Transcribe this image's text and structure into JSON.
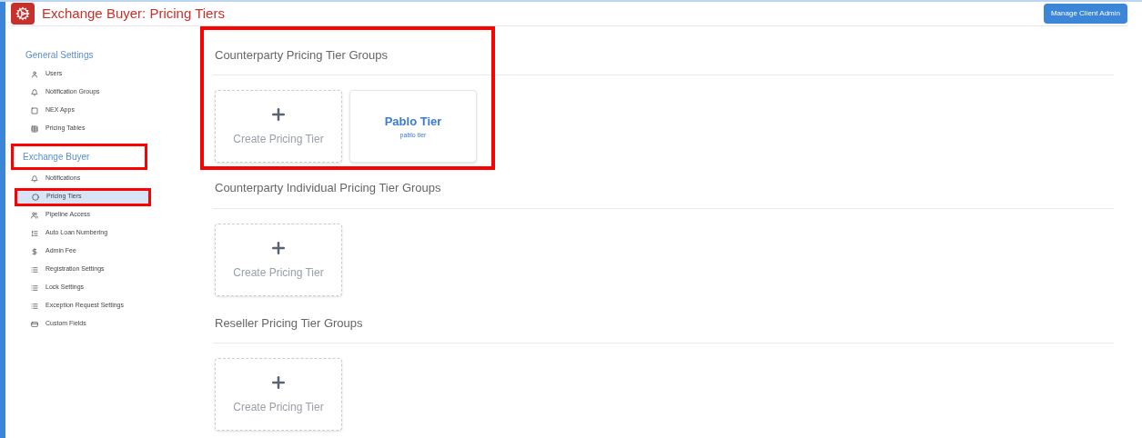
{
  "header": {
    "title": "Exchange Buyer: Pricing Tiers",
    "button": "Manage Client Admin"
  },
  "sidebar": [
    {
      "heading": "General Settings",
      "highlighted": false,
      "items": [
        {
          "label": "Users",
          "selected": false,
          "highlighted": false
        },
        {
          "label": "Notification Groups",
          "selected": false,
          "highlighted": false
        },
        {
          "label": "NEX Apps",
          "selected": false,
          "highlighted": false
        },
        {
          "label": "Pricing Tables",
          "selected": false,
          "highlighted": false
        }
      ]
    },
    {
      "heading": "Exchange Buyer",
      "highlighted": true,
      "items": [
        {
          "label": "Notifications",
          "selected": false,
          "highlighted": false
        },
        {
          "label": "Pricing Tiers",
          "selected": true,
          "highlighted": true
        },
        {
          "label": "Pipeline Access",
          "selected": false,
          "highlighted": false
        },
        {
          "label": "Auto Loan Numbering",
          "selected": false,
          "highlighted": false
        },
        {
          "label": "Admin Fee",
          "selected": false,
          "highlighted": false
        },
        {
          "label": "Registration Settings",
          "selected": false,
          "highlighted": false
        },
        {
          "label": "Lock Settings",
          "selected": false,
          "highlighted": false
        },
        {
          "label": "Exception Request Settings",
          "selected": false,
          "highlighted": false
        },
        {
          "label": "Custom Fields",
          "selected": false,
          "highlighted": false
        }
      ]
    }
  ],
  "sections": [
    {
      "title": "Counterparty Pricing Tier Groups",
      "highlighted": true,
      "cards": [
        {
          "kind": "create",
          "label": "Create Pricing Tier"
        },
        {
          "kind": "tier",
          "label": "Pablo Tier",
          "subtitle": "pablo tier"
        }
      ]
    },
    {
      "title": "Counterparty Individual Pricing Tier Groups",
      "highlighted": false,
      "cards": [
        {
          "kind": "create",
          "label": "Create Pricing Tier"
        }
      ]
    },
    {
      "title": "Reseller Pricing Tier Groups",
      "highlighted": false,
      "cards": [
        {
          "kind": "create",
          "label": "Create Pricing Tier"
        }
      ]
    }
  ]
}
